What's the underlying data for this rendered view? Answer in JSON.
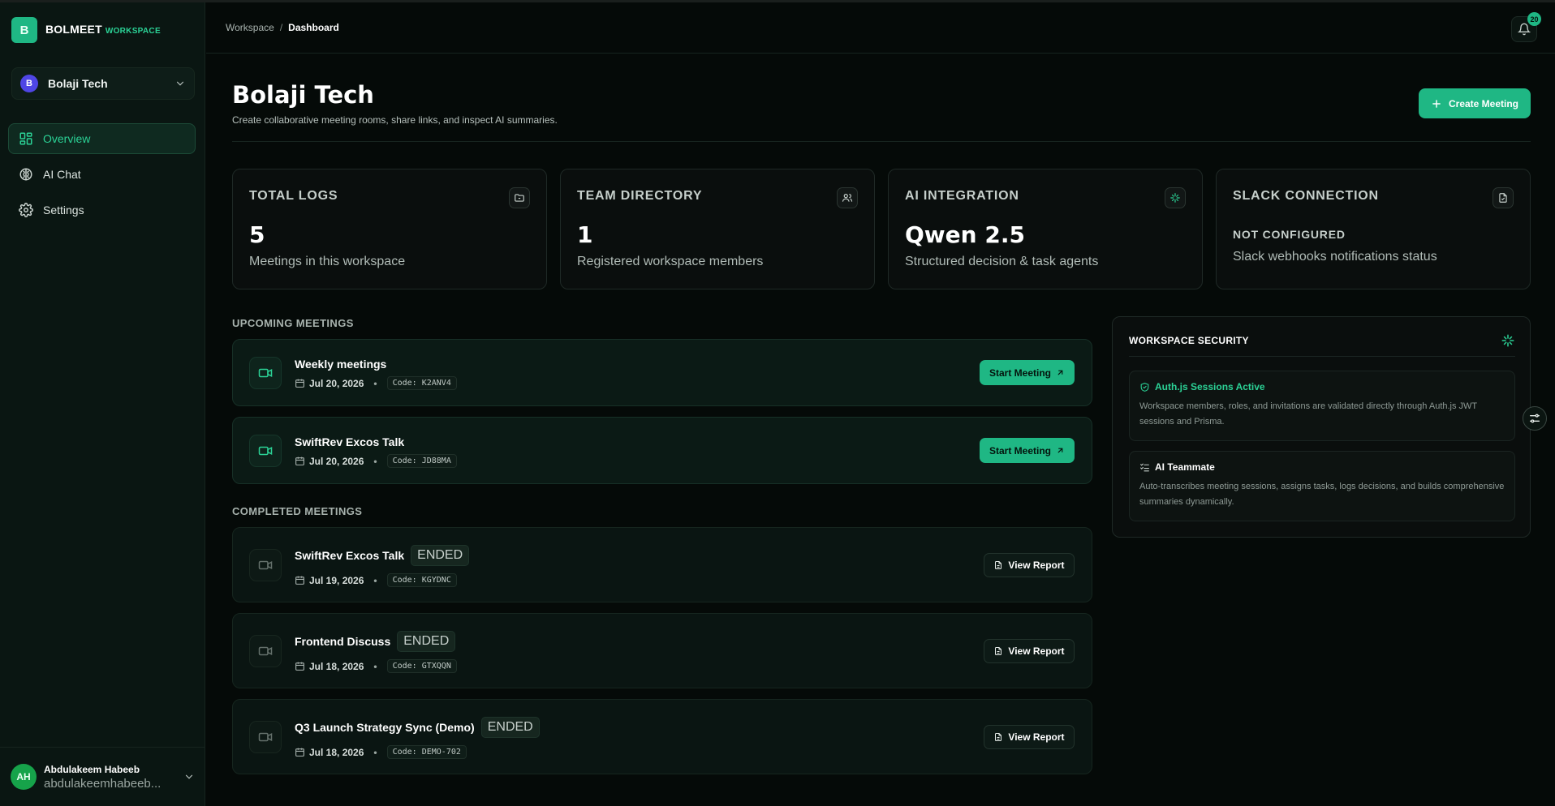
{
  "brand": {
    "logo_letter": "B",
    "name": "BOLMEET",
    "sub": "WORKSPACE",
    "color": "#1fb784"
  },
  "workspace_switcher": {
    "avatar": "B",
    "name": "Bolaji Tech"
  },
  "nav": [
    {
      "label": "Overview",
      "icon": "grid-icon",
      "active": true
    },
    {
      "label": "AI Chat",
      "icon": "ai-brain-icon"
    },
    {
      "label": "Settings",
      "icon": "gear-icon"
    }
  ],
  "user": {
    "initials": "AH",
    "name": "Abdulakeem Habeeb",
    "email": "abdulakeemhabeeb..."
  },
  "breadcrumb": {
    "root": "Workspace",
    "separator": "/",
    "current": "Dashboard"
  },
  "notifications": {
    "count": "20"
  },
  "page": {
    "title": "Bolaji Tech",
    "subtitle": "Create collaborative meeting rooms, share links, and inspect AI summaries.",
    "create_label": "Create Meeting"
  },
  "stats": [
    {
      "label": "TOTAL LOGS",
      "value": "5",
      "desc": "Meetings in this workspace",
      "icon": "folder-icon"
    },
    {
      "label": "TEAM DIRECTORY",
      "value": "1",
      "desc": "Registered workspace members",
      "icon": "users-icon"
    },
    {
      "label": "AI INTEGRATION",
      "value": "Qwen 2.5",
      "desc": "Structured decision & task agents",
      "icon": "sparkle-icon"
    },
    {
      "label": "SLACK CONNECTION",
      "value": "NOT CONFIGURED",
      "desc": "Slack webhooks notifications status",
      "icon": "document-icon"
    }
  ],
  "upcoming": {
    "heading": "UPCOMING MEETINGS",
    "action_label": "Start Meeting",
    "items": [
      {
        "title": "Weekly meetings",
        "date": "Jul 20, 2026",
        "code": "Code: K2ANV4"
      },
      {
        "title": "SwiftRev Excos Talk",
        "date": "Jul 20, 2026",
        "code": "Code: JD88MA"
      }
    ]
  },
  "completed": {
    "heading": "COMPLETED MEETINGS",
    "badge": "ENDED",
    "action_label": "View Report",
    "items": [
      {
        "title": "SwiftRev Excos Talk",
        "date": "Jul 19, 2026",
        "code": "Code: KGYDNC"
      },
      {
        "title": "Frontend Discuss",
        "date": "Jul 18, 2026",
        "code": "Code: GTXQQN"
      },
      {
        "title": "Q3 Launch Strategy Sync (Demo)",
        "date": "Jul 18, 2026",
        "code": "Code: DEMO-702"
      }
    ]
  },
  "security": {
    "heading": "WORKSPACE SECURITY",
    "cards": [
      {
        "title": "Auth.js Sessions Active",
        "text": "Workspace members, roles, and invitations are validated directly through Auth.js JWT sessions and Prisma.",
        "color": "#2bd296"
      },
      {
        "title": "AI Teammate",
        "text": "Auto-transcribes meeting sessions, assigns tasks, logs decisions, and builds comprehensive summaries dynamically.",
        "color": "#ffffff"
      }
    ]
  }
}
